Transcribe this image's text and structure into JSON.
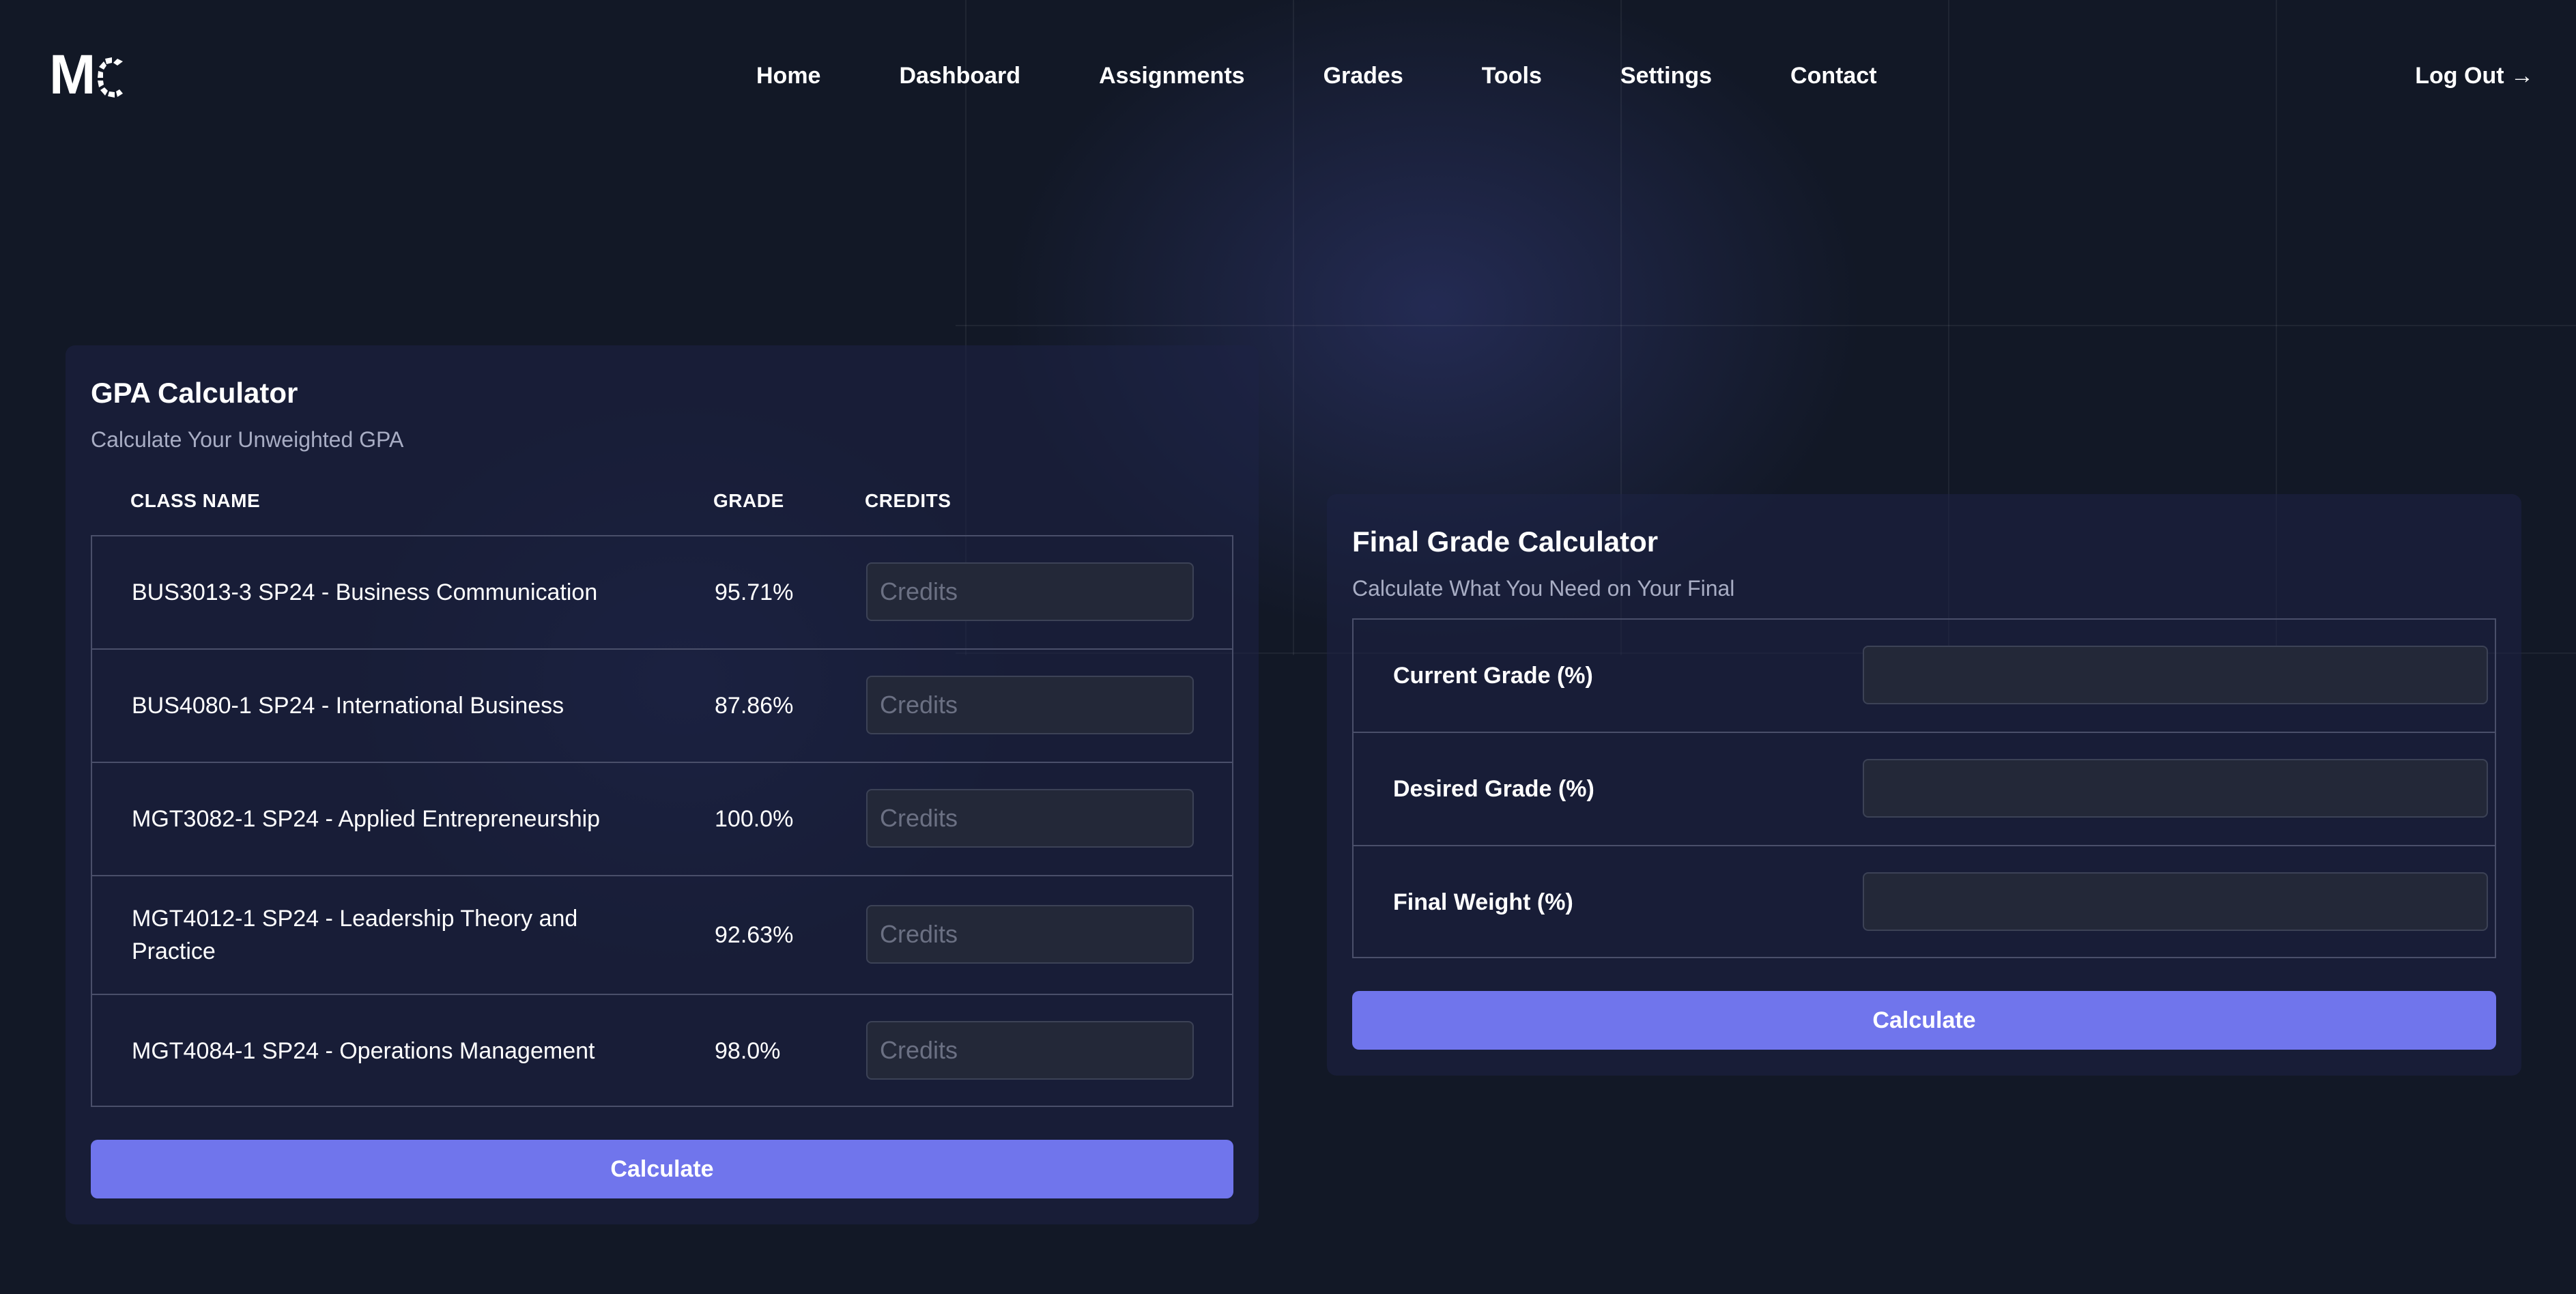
{
  "nav": {
    "logo_text": "MC",
    "links": [
      {
        "label": "Home"
      },
      {
        "label": "Dashboard"
      },
      {
        "label": "Assignments"
      },
      {
        "label": "Grades"
      },
      {
        "label": "Tools"
      },
      {
        "label": "Settings"
      },
      {
        "label": "Contact"
      }
    ],
    "logout_label": "Log Out →"
  },
  "gpa": {
    "title": "GPA Calculator",
    "subtitle": "Calculate Your Unweighted GPA",
    "columns": {
      "class_name": "CLASS NAME",
      "grade": "GRADE",
      "credits": "CREDITS"
    },
    "rows": [
      {
        "class_name": "BUS3013-3 SP24 - Business Communication",
        "grade": "95.71%",
        "credits_placeholder": "Credits",
        "credits_value": ""
      },
      {
        "class_name": "BUS4080-1 SP24 - International Business",
        "grade": "87.86%",
        "credits_placeholder": "Credits",
        "credits_value": ""
      },
      {
        "class_name": "MGT3082-1 SP24 - Applied Entrepreneurship",
        "grade": "100.0%",
        "credits_placeholder": "Credits",
        "credits_value": ""
      },
      {
        "class_name": "MGT4012-1 SP24 - Leadership Theory and Practice",
        "grade": "92.63%",
        "credits_placeholder": "Credits",
        "credits_value": ""
      },
      {
        "class_name": "MGT4084-1 SP24 - Operations Management",
        "grade": "98.0%",
        "credits_placeholder": "Credits",
        "credits_value": ""
      }
    ],
    "calculate_label": "Calculate"
  },
  "final": {
    "title": "Final Grade Calculator",
    "subtitle": "Calculate What You Need on Your Final",
    "fields": [
      {
        "label": "Current Grade (%)",
        "value": ""
      },
      {
        "label": "Desired Grade (%)",
        "value": ""
      },
      {
        "label": "Final Weight (%)",
        "value": ""
      }
    ],
    "calculate_label": "Calculate"
  },
  "colors": {
    "background": "#121826",
    "card": "#1e2246",
    "accent_button": "#7075ec",
    "input_bg": "#232838",
    "border": "#4a4f6a",
    "muted_text": "#a8adc4"
  }
}
